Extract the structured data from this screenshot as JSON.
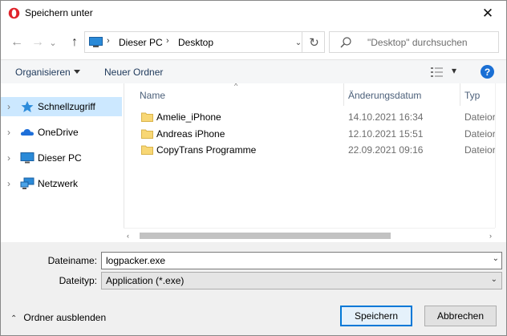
{
  "titlebar": {
    "title": "Speichern unter",
    "close_glyph": "✕",
    "app_icon": "opera-icon"
  },
  "nav": {
    "back_glyph": "←",
    "forward_glyph": "→",
    "recent_glyph": "⌄",
    "up_glyph": "↑",
    "breadcrumbs": [
      "Dieser PC",
      "Desktop"
    ],
    "crumb_separator": "›",
    "dropdown_glyph": "⌄",
    "refresh_glyph": "↻",
    "search_placeholder": "\"Desktop\" durchsuchen"
  },
  "commandbar": {
    "organize_label": "Organisieren",
    "new_folder_label": "Neuer Ordner",
    "view_dropdown_glyph": "▾",
    "help_glyph": "?"
  },
  "navpane": {
    "items": [
      {
        "label": "Schnellzugriff",
        "icon": "star-icon",
        "selected": true
      },
      {
        "label": "OneDrive",
        "icon": "cloud-icon",
        "selected": false
      },
      {
        "label": "Dieser PC",
        "icon": "computer-icon",
        "selected": false
      },
      {
        "label": "Netzwerk",
        "icon": "network-icon",
        "selected": false
      }
    ],
    "chevron_glyph": "›"
  },
  "filelist": {
    "columns": {
      "name": "Name",
      "date": "Änderungsdatum",
      "type": "Typ"
    },
    "sort_caret": "^",
    "rows": [
      {
        "name": "Amelie_iPhone",
        "date": "14.10.2021 16:34",
        "type": "Dateiordner"
      },
      {
        "name": "Andreas iPhone",
        "date": "12.10.2021 15:51",
        "type": "Dateiordner"
      },
      {
        "name": "CopyTrans Programme",
        "date": "22.09.2021 09:16",
        "type": "Dateiordner"
      }
    ],
    "scroll_left_glyph": "‹",
    "scroll_right_glyph": "›"
  },
  "form": {
    "filename_label": "Dateiname:",
    "filename_value": "logpacker.exe",
    "filetype_label": "Dateityp:",
    "filetype_value": "Application (*.exe)",
    "dropdown_glyph": "⌄"
  },
  "footer": {
    "hide_folders_label": "Ordner ausblenden",
    "hide_arrow_glyph": "⌃",
    "save_label": "Speichern",
    "cancel_label": "Abbrechen"
  },
  "colors": {
    "accent": "#0078d7",
    "selection": "#cce8ff",
    "folder": "#f8d775",
    "help": "#1a6fd4",
    "header_text": "#4c607a"
  }
}
